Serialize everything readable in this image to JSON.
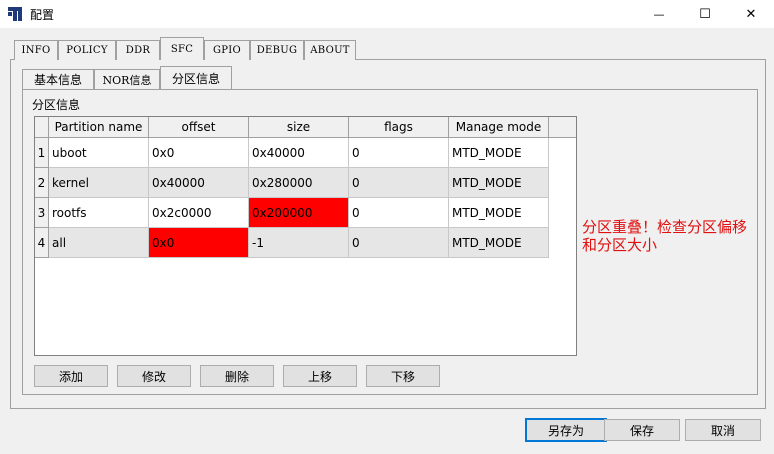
{
  "window": {
    "title": "配置",
    "minimize_glyph": "—",
    "maximize_glyph": "☐",
    "close_glyph": "✕"
  },
  "outer_tabs": [
    "INFO",
    "POLICY",
    "DDR",
    "SFC",
    "GPIO",
    "DEBUG",
    "ABOUT"
  ],
  "outer_active_tab": "SFC",
  "inner_tabs": [
    "基本信息",
    "NOR信息",
    "分区信息"
  ],
  "inner_active_tab": "分区信息",
  "group_title": "分区信息",
  "table": {
    "columns": [
      "Partition name",
      "offset",
      "size",
      "flags",
      "Manage mode"
    ],
    "rows": [
      {
        "num": "1",
        "name": "uboot",
        "offset": "0x0",
        "size": "0x40000",
        "flags": "0",
        "mode": "MTD_MODE"
      },
      {
        "num": "2",
        "name": "kernel",
        "offset": "0x40000",
        "size": "0x280000",
        "flags": "0",
        "mode": "MTD_MODE"
      },
      {
        "num": "3",
        "name": "rootfs",
        "offset": "0x2c0000",
        "size": "0x200000",
        "flags": "0",
        "mode": "MTD_MODE"
      },
      {
        "num": "4",
        "name": "all",
        "offset": "0x0",
        "size": "-1",
        "flags": "0",
        "mode": "MTD_MODE"
      }
    ],
    "error_color": "#ff0000",
    "alt_row_color": "#e6e6e6"
  },
  "table_buttons": [
    "添加",
    "修改",
    "删除",
    "上移",
    "下移"
  ],
  "warning_text": "分区重叠！检查分区偏移和分区大小",
  "warning_color": "#e01010",
  "dialog_buttons": {
    "save_as": "另存为",
    "save": "保存",
    "cancel": "取消"
  },
  "accent_color": "#0078d7"
}
